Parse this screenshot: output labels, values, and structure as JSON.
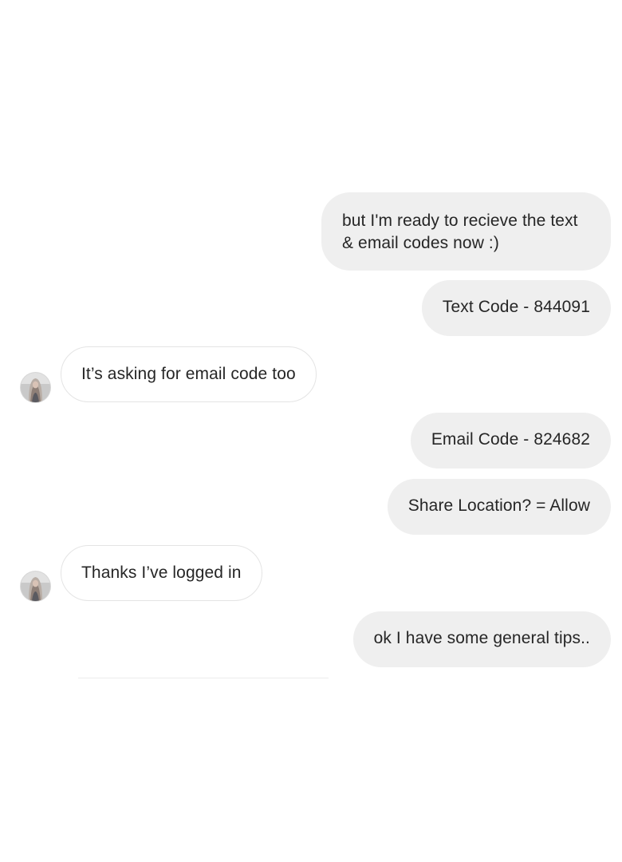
{
  "messages": [
    {
      "side": "sent",
      "text": "but I'm ready to recieve the text & email codes now :)"
    },
    {
      "side": "sent",
      "text": "Text Code - 844091"
    },
    {
      "side": "received",
      "text": "It’s asking for email code too"
    },
    {
      "side": "sent",
      "text": "Email Code - 824682"
    },
    {
      "side": "sent",
      "text": "Share Location? = Allow"
    },
    {
      "side": "received",
      "text": "Thanks I’ve logged in"
    },
    {
      "side": "sent",
      "text": "ok I have some general tips.."
    }
  ],
  "colors": {
    "sent_bubble": "#efefef",
    "received_bubble": "#ffffff",
    "received_border": "#e4e4e4",
    "text": "#262626"
  },
  "icons": {
    "avatar": "contact-avatar-photo"
  }
}
